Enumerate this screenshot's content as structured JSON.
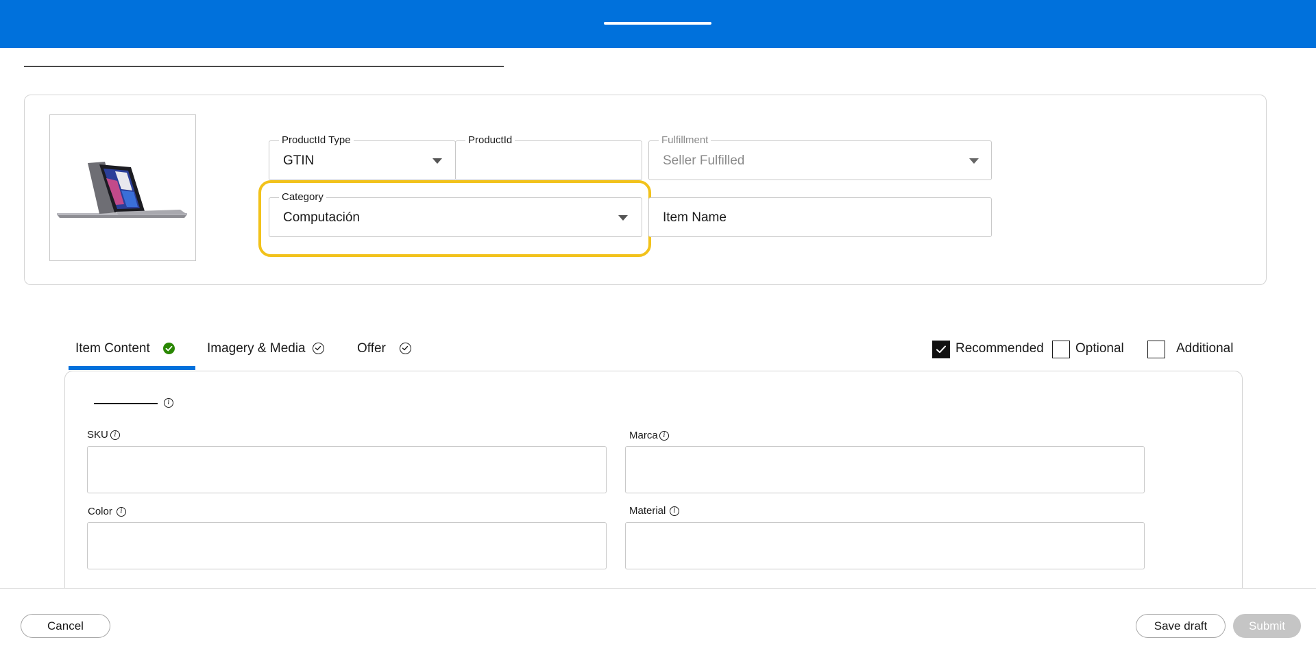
{
  "header": {
    "title": ""
  },
  "page": {
    "heading": ""
  },
  "product": {
    "image_alt": "laptop",
    "fields": {
      "productid_type": {
        "label": "ProductId Type",
        "value": "GTIN"
      },
      "productid": {
        "label": "ProductId",
        "value": ""
      },
      "fulfillment": {
        "label": "Fulfillment",
        "value": "Seller Fulfilled"
      },
      "category": {
        "label": "Category",
        "value": "Computación"
      },
      "item_name": {
        "label": "",
        "placeholder": "Item Name"
      }
    }
  },
  "tabs": [
    {
      "label": "Item Content",
      "status": "complete"
    },
    {
      "label": "Imagery & Media",
      "status": "pending"
    },
    {
      "label": "Offer",
      "status": "pending"
    }
  ],
  "filters": [
    {
      "label": "Recommended",
      "checked": true
    },
    {
      "label": "Optional",
      "checked": false
    },
    {
      "label": "Additional",
      "checked": false
    }
  ],
  "section": {
    "title": ""
  },
  "attributes": [
    {
      "label": "SKU",
      "value": ""
    },
    {
      "label": "Marca",
      "value": ""
    },
    {
      "label": "Color",
      "value": ""
    },
    {
      "label": "Material",
      "value": ""
    }
  ],
  "footer": {
    "cancel_label": "Cancel",
    "save_draft_label": "Save draft",
    "submit_label": "Submit"
  },
  "colors": {
    "brand_blue": "#0071dc",
    "highlight": "#f2c21b",
    "success_green": "#2a8703"
  }
}
